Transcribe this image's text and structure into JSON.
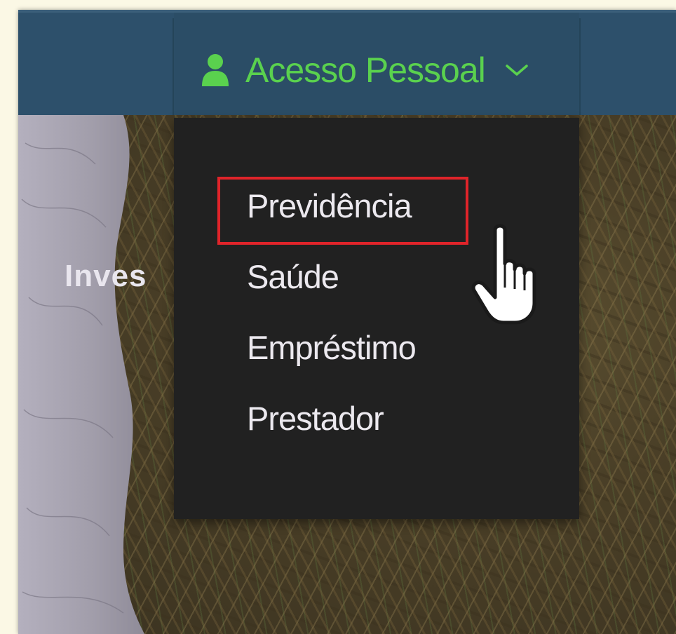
{
  "nav": {
    "item_label": "Acesso Pessoal",
    "accent_color": "#5ad14e",
    "bar_color": "#2d506b",
    "underline_color": "#2fa84a",
    "icons": {
      "user": "user-icon",
      "chevron": "chevron-down-icon"
    }
  },
  "hero": {
    "text": "Inves"
  },
  "dropdown": {
    "items": [
      {
        "label": "Previdência",
        "highlighted": true
      },
      {
        "label": "Saúde"
      },
      {
        "label": "Empréstimo"
      },
      {
        "label": "Prestador"
      }
    ],
    "background": "#212121",
    "highlight_color": "#e0242a"
  },
  "cursor": {
    "icon": "hand-pointer-icon"
  }
}
